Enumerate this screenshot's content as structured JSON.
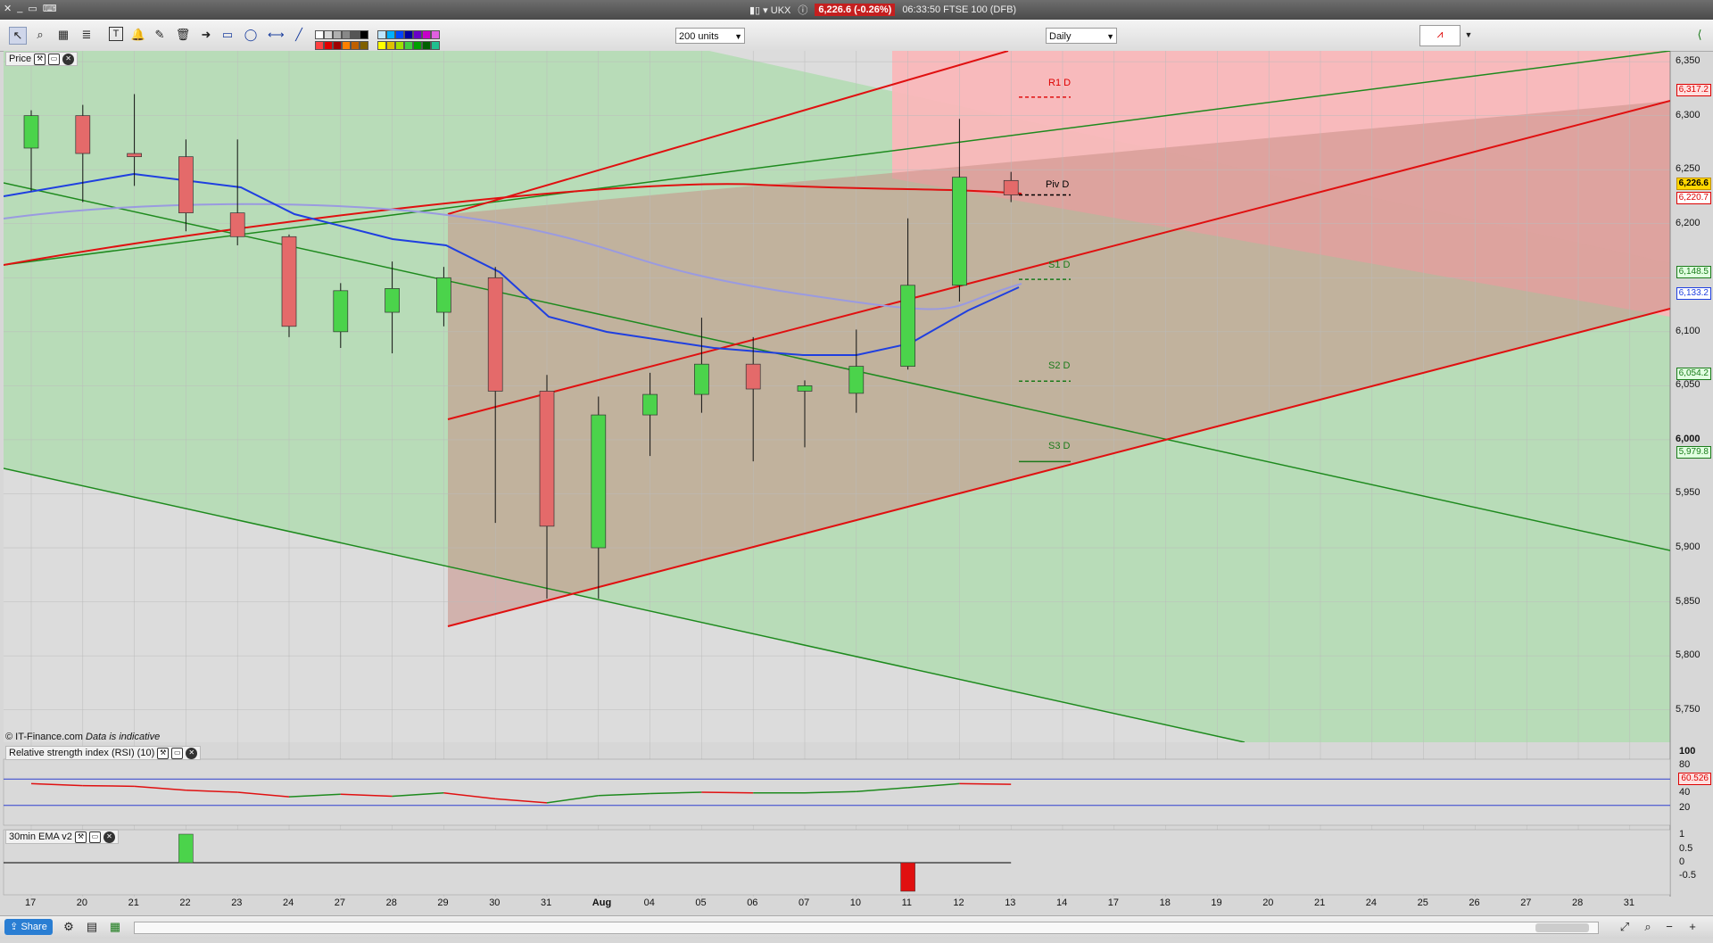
{
  "window": {
    "instrument": "UKX",
    "last_price_badge": "6,226.6 (-0.26%)",
    "time_market": "06:33:50 FTSE 100 (DFB)"
  },
  "toolbar": {
    "units_select": "200 units",
    "interval_select": "Daily"
  },
  "price_panel": {
    "title": "Price",
    "copyright": "© IT-Finance.com",
    "disclaimer": "Data is indicative",
    "y_ticks": [
      "6,350",
      "6,300",
      "6,250",
      "6,200",
      "6,100",
      "6,050",
      "6,000",
      "5,950",
      "5,900",
      "5,850",
      "5,800",
      "5,750"
    ],
    "pivot_labels": {
      "r1": "R1 D",
      "piv": "Piv D",
      "s1": "S1 D",
      "s2": "S2 D",
      "s3": "S3 D"
    },
    "price_tags": {
      "r1": "6,317.2",
      "last": "6,226.6",
      "ma_red": "6,220.7",
      "s1": "6,148.5",
      "ma_blue": "6,133.2",
      "s2": "6,054.2",
      "s3": "5,979.8"
    }
  },
  "rsi_panel": {
    "title": "Relative strength index (RSI) (10)",
    "y_ticks": [
      "100",
      "80",
      "40",
      "20"
    ],
    "value_tag": "60.526"
  },
  "ema_panel": {
    "title": "30min EMA v2",
    "y_ticks": [
      "1",
      "0.5",
      "0",
      "-0.5"
    ]
  },
  "x_axis": {
    "labels": [
      "17",
      "20",
      "21",
      "22",
      "23",
      "24",
      "27",
      "28",
      "29",
      "30",
      "31",
      "Aug",
      "04",
      "05",
      "06",
      "07",
      "10",
      "11",
      "12",
      "13",
      "14",
      "17",
      "18",
      "19",
      "20",
      "21",
      "24",
      "25",
      "26",
      "27",
      "28",
      "31"
    ]
  },
  "bottom": {
    "share_label": "Share"
  },
  "colors": {
    "bull": "#4bd34b",
    "bear": "#e46a6a",
    "green_channel": "#1e8a1e",
    "red_channel": "#e01010",
    "ma_blue": "#1f3fe0",
    "ma_lavender": "#9a9ae0"
  },
  "chart_data": {
    "type": "candlestick",
    "ohlc": [
      {
        "date": "17",
        "open": 6270,
        "high": 6305,
        "low": 6230,
        "close": 6300
      },
      {
        "date": "20",
        "open": 6300,
        "high": 6310,
        "low": 6220,
        "close": 6265
      },
      {
        "date": "21",
        "open": 6265,
        "high": 6320,
        "low": 6235,
        "close": 6262
      },
      {
        "date": "22",
        "open": 6262,
        "high": 6278,
        "low": 6193,
        "close": 6210
      },
      {
        "date": "23",
        "open": 6210,
        "high": 6278,
        "low": 6180,
        "close": 6188
      },
      {
        "date": "24",
        "open": 6188,
        "high": 6190,
        "low": 6095,
        "close": 6105
      },
      {
        "date": "27",
        "open": 6100,
        "high": 6145,
        "low": 6085,
        "close": 6138
      },
      {
        "date": "28",
        "open": 6118,
        "high": 6165,
        "low": 6080,
        "close": 6140
      },
      {
        "date": "29",
        "open": 6118,
        "high": 6160,
        "low": 6105,
        "close": 6150
      },
      {
        "date": "30",
        "open": 6150,
        "high": 6160,
        "low": 5923,
        "close": 6045
      },
      {
        "date": "31",
        "open": 6045,
        "high": 6060,
        "low": 5853,
        "close": 5920
      },
      {
        "date": "Aug",
        "open": 5900,
        "high": 6040,
        "low": 5853,
        "close": 6023
      },
      {
        "date": "04",
        "open": 6023,
        "high": 6062,
        "low": 5985,
        "close": 6042
      },
      {
        "date": "05",
        "open": 6042,
        "high": 6113,
        "low": 6025,
        "close": 6070
      },
      {
        "date": "06",
        "open": 6070,
        "high": 6095,
        "low": 5980,
        "close": 6047
      },
      {
        "date": "07",
        "open": 6045,
        "high": 6055,
        "low": 5993,
        "close": 6050
      },
      {
        "date": "10",
        "open": 6043,
        "high": 6102,
        "low": 6025,
        "close": 6068
      },
      {
        "date": "11",
        "open": 6068,
        "high": 6205,
        "low": 6065,
        "close": 6143
      },
      {
        "date": "12",
        "open": 6143,
        "high": 6297,
        "low": 6128,
        "close": 6243
      },
      {
        "date": "13",
        "open": 6240,
        "high": 6248,
        "low": 6220,
        "close": 6226.6
      }
    ],
    "rsi": [
      63,
      60,
      59,
      53,
      50,
      43,
      47,
      44,
      49,
      40,
      34,
      45,
      48,
      50,
      49,
      49,
      51,
      57,
      63,
      62
    ],
    "ema_hist": [
      0,
      0,
      0,
      1,
      0,
      0,
      0,
      0,
      0,
      0,
      0,
      0,
      0,
      0,
      0,
      0,
      0,
      -1,
      0,
      0
    ],
    "ylim": [
      5720,
      6360
    ],
    "pivots": {
      "R1": 6317.2,
      "Piv": 6226.6,
      "S1": 6148.5,
      "S2": 6054.2,
      "S3": 5979.8
    }
  }
}
